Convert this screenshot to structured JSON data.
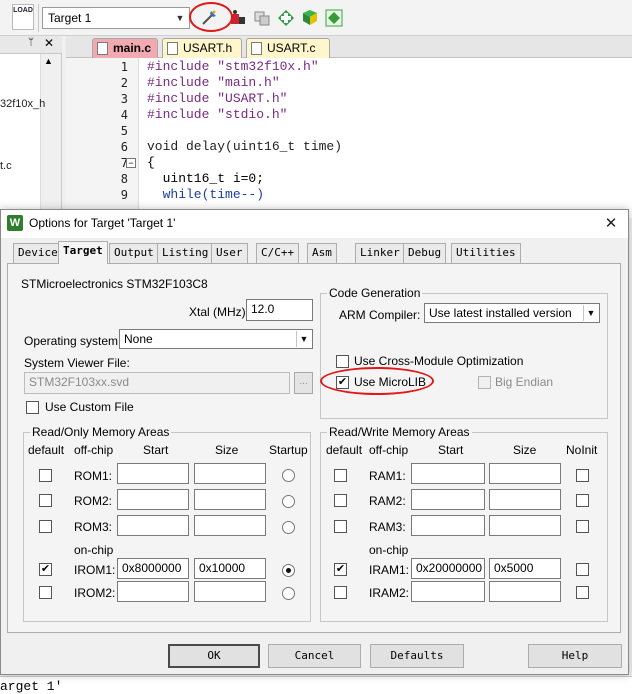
{
  "ide": {
    "load_icon_text": "LOAD",
    "target_combo": "Target 1",
    "left_panel": {
      "fragment_1": "32f10x_h",
      "fragment_2": "t.c"
    },
    "file_tabs": [
      "main.c",
      "USART.h",
      "USART.c"
    ],
    "line_numbers": [
      "1",
      "2",
      "3",
      "4",
      "5",
      "6",
      "7",
      "8",
      "9"
    ],
    "code_lines": [
      "#include \"stm32f10x.h\"",
      "#include \"main.h\"",
      "#include \"USART.h\"",
      "#include \"stdio.h\"",
      "",
      "void delay(uint16_t time)",
      "{",
      "  uint16_t i=0;",
      "  while(time--)"
    ],
    "status_text": "arget 1'",
    "colors": {
      "active_tab": "#f2a9b2",
      "inactive_tab": "#fff6cc",
      "code_preprocessor": "#7a2a86",
      "code_string": "#1a3ea8",
      "code_keyword": "#1a3ea8"
    }
  },
  "dialog": {
    "title": "Options for Target 'Target 1'",
    "close_glyph": "✕",
    "tabs": [
      "Device",
      "Target",
      "Output",
      "Listing",
      "User",
      "C/C++",
      "Asm",
      "Linker",
      "Debug",
      "Utilities"
    ],
    "active_tab": "Target",
    "device_name": "STMicroelectronics STM32F103C8",
    "xtal_label": "Xtal (MHz):",
    "xtal_value": "12.0",
    "os_label": "Operating system:",
    "os_value": "None",
    "svd_label": "System Viewer File:",
    "svd_value": "STM32F103xx.svd",
    "svd_browse": "...",
    "custom_file_label": "Use Custom File",
    "custom_file_checked": false,
    "code_gen": {
      "title": "Code Generation",
      "compiler_label": "ARM Compiler:",
      "compiler_value": "Use latest installed version",
      "cross_module_label": "Use Cross-Module Optimization",
      "cross_module_checked": false,
      "microlib_label": "Use MicroLIB",
      "microlib_checked": true,
      "big_endian_label": "Big Endian",
      "big_endian_checked": false
    },
    "ro_memory": {
      "title": "Read/Only Memory Areas",
      "headers": {
        "default": "default",
        "offchip": "off-chip",
        "start": "Start",
        "size": "Size",
        "extra": "Startup"
      },
      "onchip_label": "on-chip",
      "rows": [
        {
          "name": "ROM1:",
          "start": "",
          "size": "",
          "default": false,
          "startup": false
        },
        {
          "name": "ROM2:",
          "start": "",
          "size": "",
          "default": false,
          "startup": false
        },
        {
          "name": "ROM3:",
          "start": "",
          "size": "",
          "default": false,
          "startup": false
        },
        {
          "name": "IROM1:",
          "start": "0x8000000",
          "size": "0x10000",
          "default": true,
          "startup": true
        },
        {
          "name": "IROM2:",
          "start": "",
          "size": "",
          "default": false,
          "startup": false
        }
      ]
    },
    "rw_memory": {
      "title": "Read/Write Memory Areas",
      "headers": {
        "default": "default",
        "offchip": "off-chip",
        "start": "Start",
        "size": "Size",
        "extra": "NoInit"
      },
      "onchip_label": "on-chip",
      "rows": [
        {
          "name": "RAM1:",
          "start": "",
          "size": "",
          "default": false,
          "noinit": false
        },
        {
          "name": "RAM2:",
          "start": "",
          "size": "",
          "default": false,
          "noinit": false
        },
        {
          "name": "RAM3:",
          "start": "",
          "size": "",
          "default": false,
          "noinit": false
        },
        {
          "name": "IRAM1:",
          "start": "0x20000000",
          "size": "0x5000",
          "default": true,
          "noinit": false
        },
        {
          "name": "IRAM2:",
          "start": "",
          "size": "",
          "default": false,
          "noinit": false
        }
      ]
    },
    "buttons": {
      "ok": "OK",
      "cancel": "Cancel",
      "defaults": "Defaults",
      "help": "Help"
    }
  },
  "annotations": {
    "circle_color": "#e01818"
  }
}
